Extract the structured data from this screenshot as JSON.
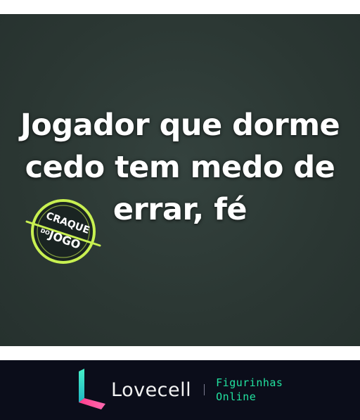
{
  "sticker": {
    "caption_lines": [
      "Jogador que dorme",
      "cedo tem medo de",
      "errar, fé"
    ],
    "badge": {
      "top_text": "CRAQUE",
      "small_text": "DO",
      "bottom_text": "JOGO"
    }
  },
  "footer": {
    "brand_name": "Lovecell",
    "tag_line_1": "Figurinhas",
    "tag_line_2": "Online"
  },
  "colors": {
    "sticker_background": "#2b3733",
    "badge_ring": "#c8f051",
    "footer_background": "#0b0d1a",
    "brand_accent": "#22e3a0",
    "logo_pink": "#ff3d8b"
  },
  "icons": {
    "badge": "craque-do-jogo-badge-icon",
    "logo": "lovecell-logo-icon"
  }
}
